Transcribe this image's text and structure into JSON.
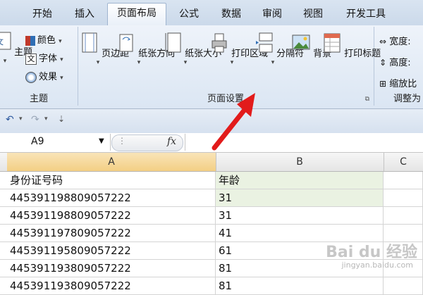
{
  "tabs": [
    {
      "label": "开始"
    },
    {
      "label": "插入"
    },
    {
      "label": "页面布局"
    },
    {
      "label": "公式"
    },
    {
      "label": "数据"
    },
    {
      "label": "审阅"
    },
    {
      "label": "视图"
    },
    {
      "label": "开发工具"
    }
  ],
  "ribbon": {
    "theme_group": {
      "label": "主题",
      "theme_btn": "主题",
      "colors": "颜色",
      "fonts": "字体",
      "effects": "效果"
    },
    "page_setup_group": {
      "label": "页面设置",
      "buttons": [
        "页边距",
        "纸张方向",
        "纸张大小",
        "打印区域",
        "分隔符",
        "背景",
        "打印标题"
      ]
    },
    "scale_group": {
      "label": "调整为",
      "width": "宽度:",
      "height": "高度:",
      "scale": "缩放比"
    }
  },
  "formula_bar": {
    "name_box": "A9",
    "fx": "fx"
  },
  "columns": [
    "A",
    "B",
    "C"
  ],
  "rows": [
    {
      "a": "身份证号码",
      "b": "年龄"
    },
    {
      "a": "445391198809057222",
      "b": "31"
    },
    {
      "a": "445391198809057222",
      "b": "31"
    },
    {
      "a": "445391197809057222",
      "b": "41"
    },
    {
      "a": "445391195809057222",
      "b": "61"
    },
    {
      "a": "445391193809057222",
      "b": "81"
    },
    {
      "a": "445391193809057222",
      "b": "81"
    }
  ],
  "watermark": {
    "text": "Bai du 经验",
    "url": "jingyan.baidu.com"
  },
  "colors": {
    "accent_arrow": "#e21b1b",
    "selected_col": "#f3cf84",
    "tab_bg": "#cbd9ea"
  }
}
